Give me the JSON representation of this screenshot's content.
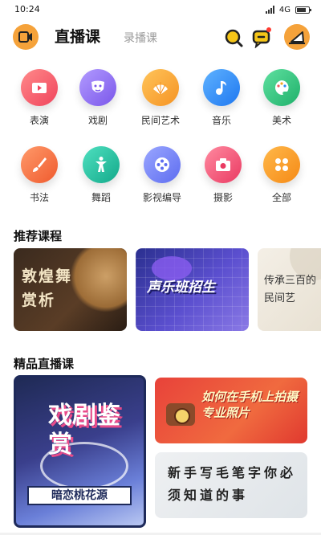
{
  "status_bar": {
    "time": "10:24",
    "network": "4G",
    "battery_level": 0.8
  },
  "header": {
    "tab_live": "直播课",
    "tab_recorded": "录播课",
    "icons": [
      "video-camera-icon",
      "search-icon",
      "message-icon",
      "avatar-icon"
    ]
  },
  "categories": [
    {
      "label": "表演",
      "icon": "tv-icon",
      "color": "#f25a6a"
    },
    {
      "label": "戏剧",
      "icon": "mask-icon",
      "color": "#8a6cf0"
    },
    {
      "label": "民间艺术",
      "icon": "fan-icon",
      "color": "#f5a623"
    },
    {
      "label": "音乐",
      "icon": "music-note-icon",
      "color": "#2f8cf5"
    },
    {
      "label": "美术",
      "icon": "palette-icon",
      "color": "#2fc07a"
    },
    {
      "label": "书法",
      "icon": "brush-icon",
      "color": "#f0673a"
    },
    {
      "label": "舞蹈",
      "icon": "dancer-icon",
      "color": "#1fbf9a"
    },
    {
      "label": "影视编导",
      "icon": "film-reel-icon",
      "color": "#6f7ff5"
    },
    {
      "label": "摄影",
      "icon": "camera-icon",
      "color": "#f04a6a"
    },
    {
      "label": "全部",
      "icon": "grid-icon",
      "color": "#f59a23"
    }
  ],
  "sections": {
    "recommended_title": "推荐课程",
    "live_title": "精品直播课"
  },
  "recommended": [
    {
      "title": "敦煌舞赏析"
    },
    {
      "title": "声乐班招生"
    },
    {
      "title": "传承三百的民间艺"
    }
  ],
  "live_courses": {
    "featured_title": "戏剧鉴赏",
    "featured_subtitle": "暗恋桃花源",
    "card_2_title": "如何在手机上拍摄专业照片",
    "card_3_title": "新手写毛笔字你必须知道的事"
  }
}
